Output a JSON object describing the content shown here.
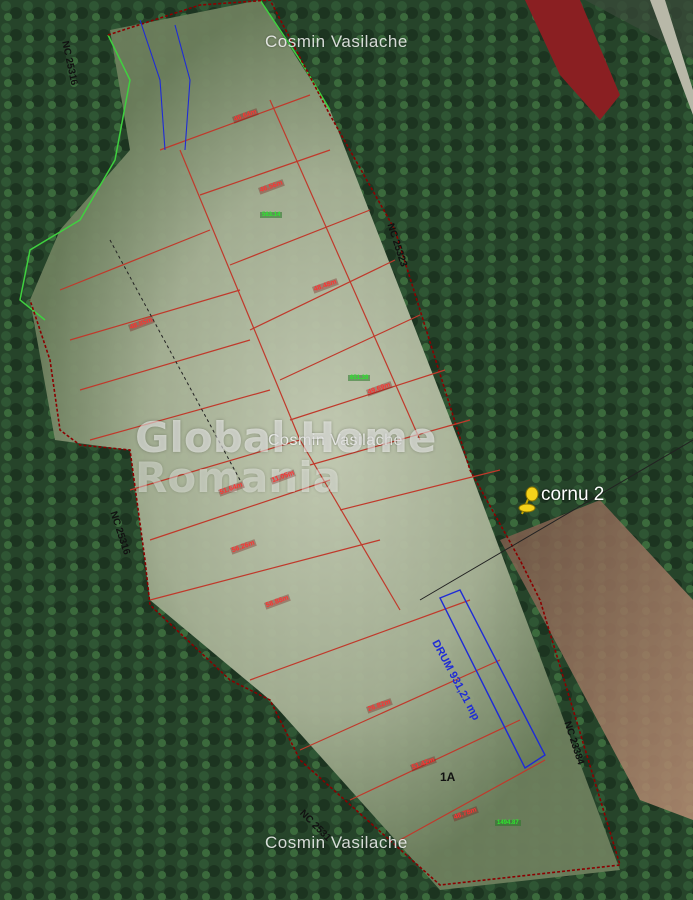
{
  "map": {
    "watermarks": {
      "top": "Cosmin Vasilache",
      "middle": "Cosmin Vasilache",
      "bottom": "Cosmin Vasilache"
    },
    "brand": {
      "line1": "Global Home",
      "line2": "Romania"
    },
    "marker": {
      "label": "cornu 2",
      "color": "#f4d21a"
    },
    "road": {
      "label": "DRUM 931,21 mp",
      "color": "#1e2bd6"
    },
    "cadastral_refs": {
      "nc_top_left": "NC 25316",
      "nc_right_top": "NC 25323",
      "nc_left_mid": "NC 25316",
      "nc_right_bottom": "NC 23384",
      "nc_bottom": "NC 2531"
    },
    "lot_label": "1A",
    "dimensions": [
      "46.64m",
      "46.56m",
      "48.85m",
      "48.48m",
      "49.69m",
      "51.64m",
      "56.26m",
      "58.88m",
      "26.82m",
      "51.42m",
      "48.78m",
      "11.05m"
    ],
    "lot_areas": [
      "1494.87",
      "651.39",
      "563.14"
    ],
    "colors": {
      "parcel_outline": "#ff3030",
      "lot_line": "#c0392b",
      "area_label": "#2ee82e",
      "boundary_green": "#3fd13f"
    }
  }
}
